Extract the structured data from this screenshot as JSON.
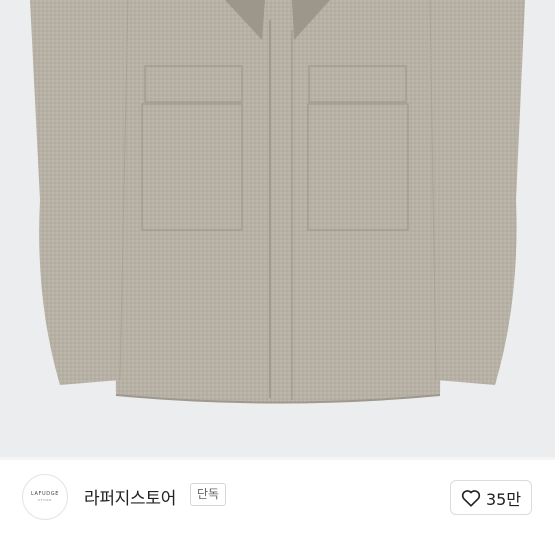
{
  "product": {
    "image_alt": "Beige wool jacket",
    "background_color": "#ecedef",
    "fabric_color": "#b9b2a7"
  },
  "seller": {
    "logo_text": "LAFUDGE",
    "logo_subtext": "STORE",
    "name": "라퍼지스토어",
    "badge": "단독"
  },
  "like": {
    "icon": "heart-icon",
    "count": "35만"
  }
}
